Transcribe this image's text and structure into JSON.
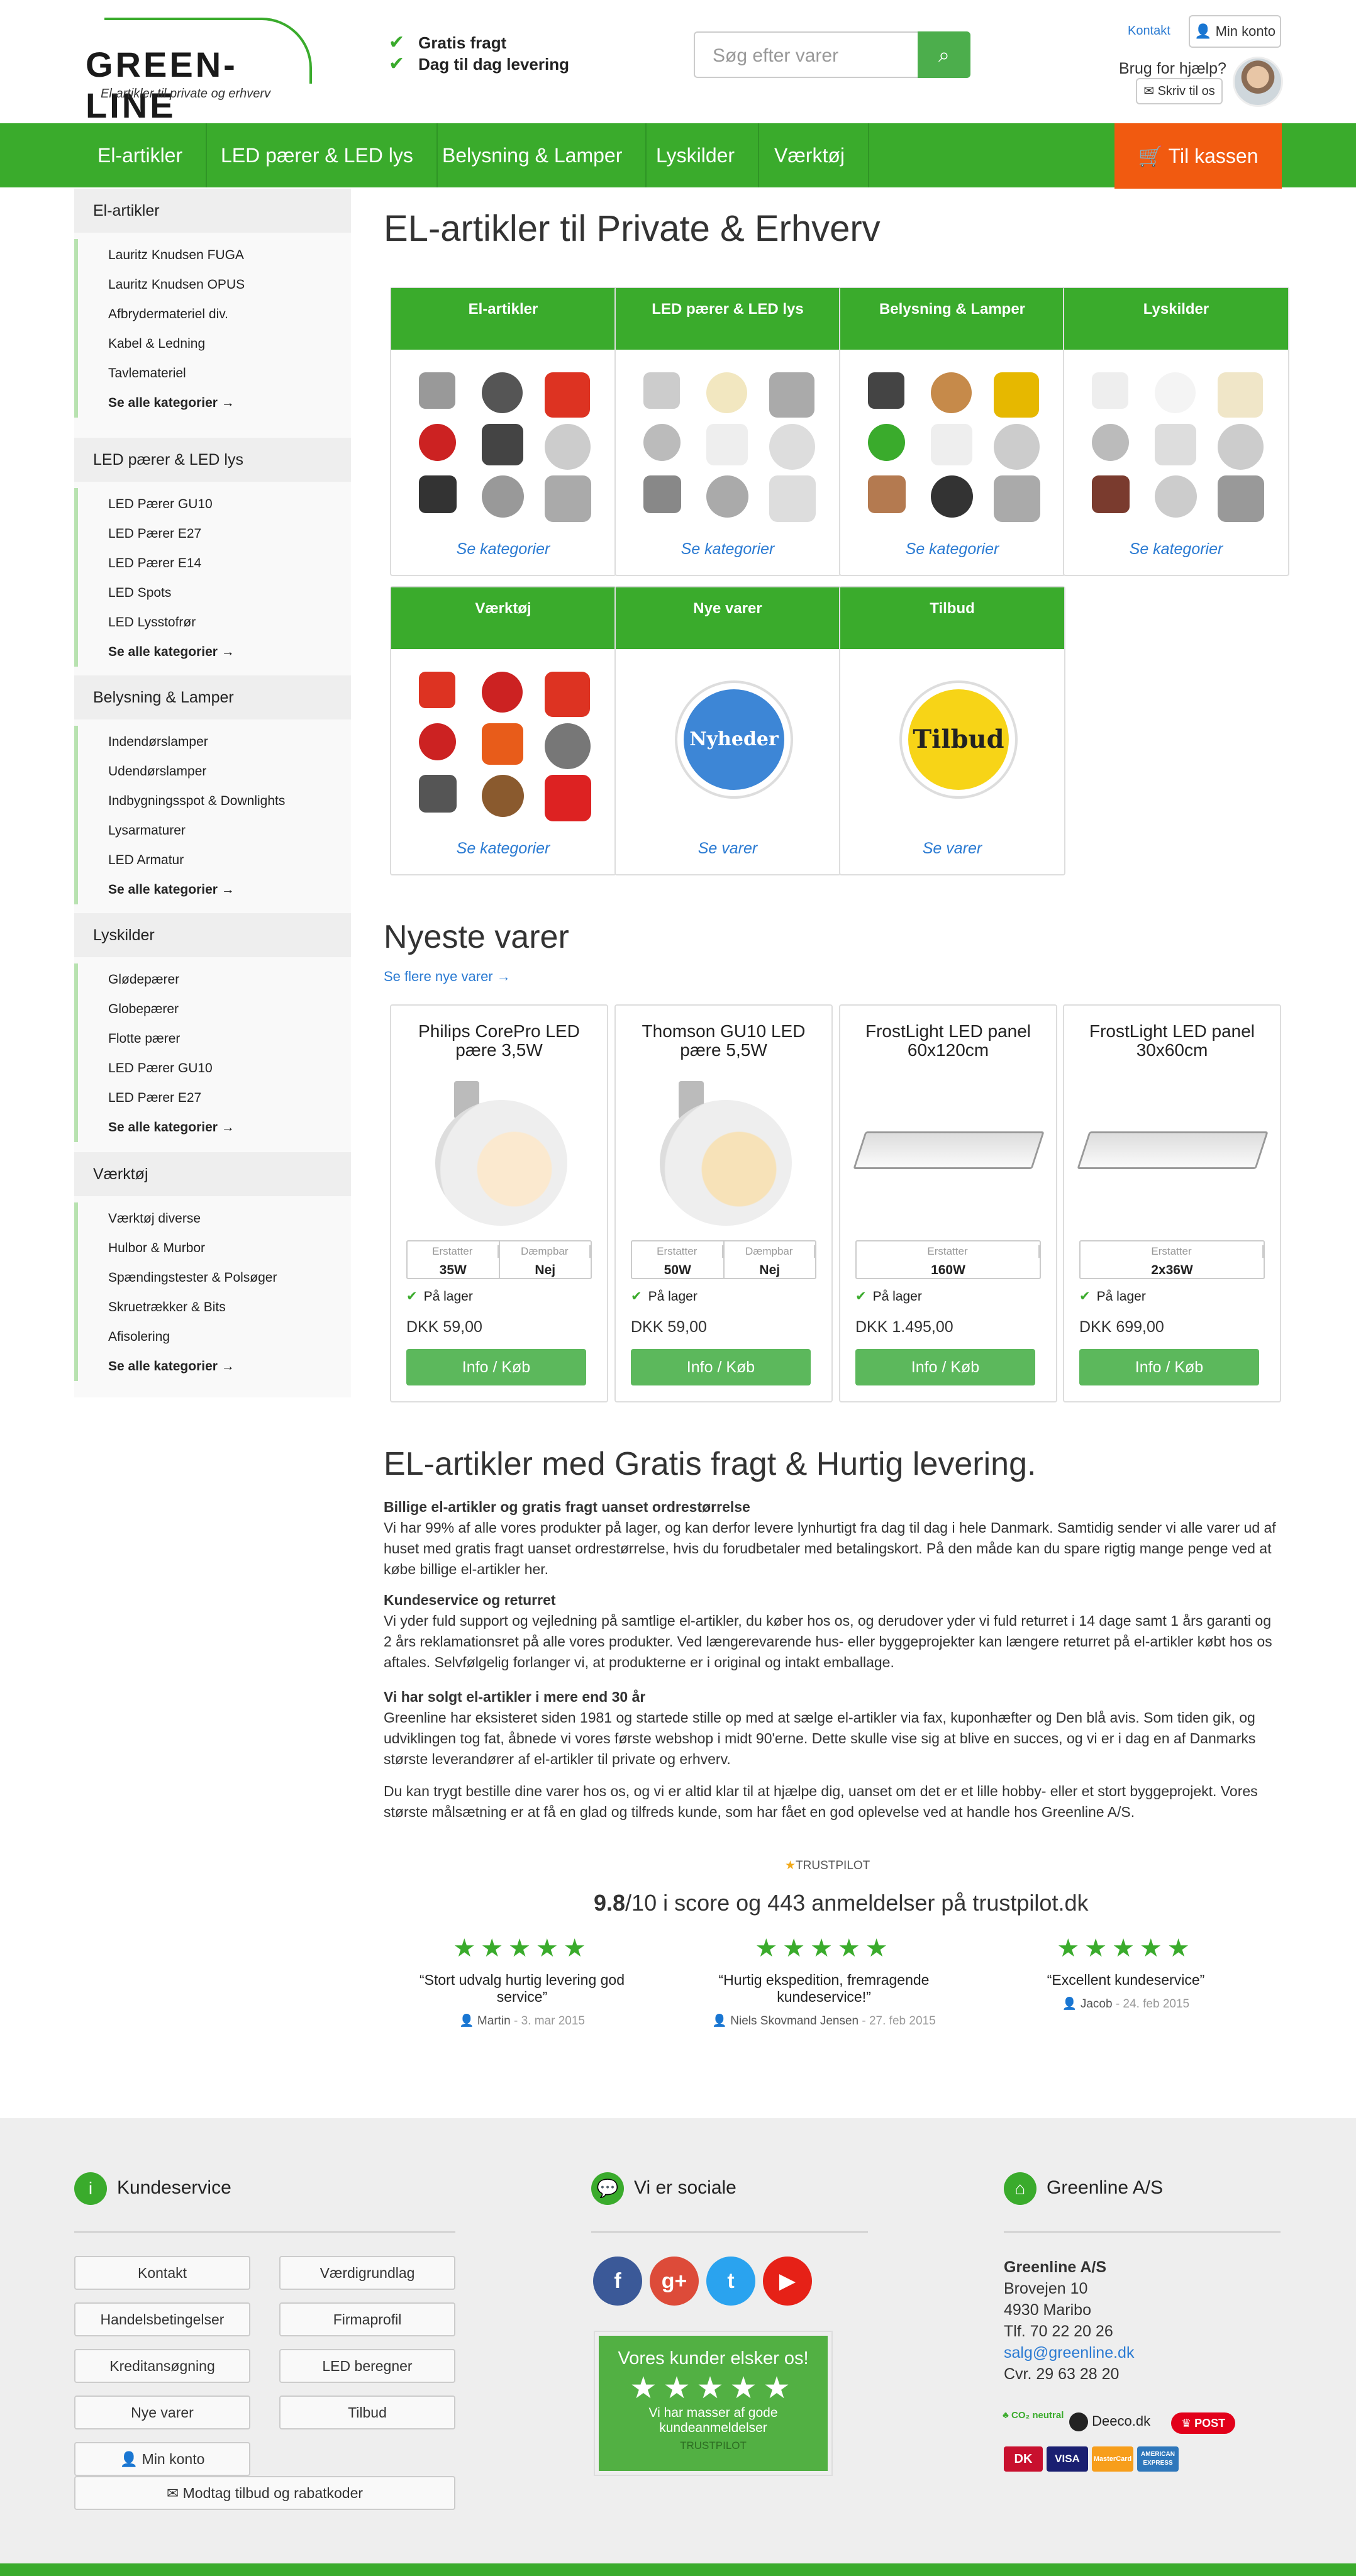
{
  "header": {
    "logo_text": "GREEN-LINE",
    "logo_tagline": "El-artikler til private og erhverv",
    "usps": [
      "Gratis fragt",
      "Dag til dag levering"
    ],
    "search_placeholder": "Søg efter varer",
    "contact_link": "Kontakt",
    "account_btn": "Min konto",
    "help_text": "Brug for hjælp?",
    "write_btn": "Skriv til os"
  },
  "nav": {
    "items": [
      "El-artikler",
      "LED pærer & LED lys",
      "Belysning & Lamper",
      "Lyskilder",
      "Værktøj"
    ],
    "checkout": "Til kassen"
  },
  "sidebar": [
    {
      "title": "El-artikler",
      "items": [
        "Lauritz Knudsen FUGA",
        "Lauritz Knudsen OPUS",
        "Afbrydermateriel div.",
        "Kabel & Ledning",
        "Tavlemateriel"
      ],
      "more": "Se alle kategorier →"
    },
    {
      "title": "LED pærer & LED lys",
      "items": [
        "LED Pærer GU10",
        "LED Pærer E27",
        "LED Pærer E14",
        "LED Spots",
        "LED Lysstofrør"
      ],
      "more": "Se alle kategorier →"
    },
    {
      "title": "Belysning & Lamper",
      "items": [
        "Indendørslamper",
        "Udendørslamper",
        "Indbygningsspot & Downlights",
        "Lysarmaturer",
        "LED Armatur"
      ],
      "more": "Se alle kategorier →"
    },
    {
      "title": "Lyskilder",
      "items": [
        "Glødepærer",
        "Globepærer",
        "Flotte pærer",
        "LED Pærer GU10",
        "LED Pærer E27"
      ],
      "more": "Se alle kategorier →"
    },
    {
      "title": "Værktøj",
      "items": [
        "Værktøj diverse",
        "Hulbor & Murbor",
        "Spændingstester & Polsøger",
        "Skruetrækker & Bits",
        "Afisolering"
      ],
      "more": "Se alle kategorier →"
    }
  ],
  "main": {
    "title": "EL-artikler til Private & Erhverv",
    "categories": [
      {
        "name": "El-artikler",
        "link": "Se kategorier"
      },
      {
        "name": "LED pærer & LED lys",
        "link": "Se kategorier"
      },
      {
        "name": "Belysning & Lamper",
        "link": "Se kategorier"
      },
      {
        "name": "Lyskilder",
        "link": "Se kategorier"
      },
      {
        "name": "Værktøj",
        "link": "Se kategorier"
      },
      {
        "name": "Nye varer",
        "link": "Se varer",
        "badge": "Nyheder"
      },
      {
        "name": "Tilbud",
        "link": "Se varer",
        "badge": "Tilbud"
      }
    ],
    "newest_title": "Nyeste varer",
    "newest_link": "Se flere nye varer →",
    "products": [
      {
        "title": "Philips CorePro LED pære 3,5W",
        "specs": [
          {
            "label": "Erstatter",
            "value": "35W"
          },
          {
            "label": "Dæmpbar",
            "value": "Nej"
          }
        ],
        "stock": "På lager",
        "price": "DKK 59,00",
        "button": "Info / Køb"
      },
      {
        "title": "Thomson GU10 LED pære 5,5W",
        "specs": [
          {
            "label": "Erstatter",
            "value": "50W"
          },
          {
            "label": "Dæmpbar",
            "value": "Nej"
          }
        ],
        "stock": "På lager",
        "price": "DKK 59,00",
        "button": "Info / Køb"
      },
      {
        "title": "FrostLight LED panel 60x120cm",
        "specs": [
          {
            "label": "Erstatter",
            "value": "160W"
          }
        ],
        "stock": "På lager",
        "price": "DKK 1.495,00",
        "button": "Info / Køb"
      },
      {
        "title": "FrostLight LED panel 30x60cm",
        "specs": [
          {
            "label": "Erstatter",
            "value": "2x36W"
          }
        ],
        "stock": "På lager",
        "price": "DKK 699,00",
        "button": "Info / Køb"
      }
    ],
    "info_title": "EL-artikler med Gratis fragt & Hurtig levering.",
    "info_sections": [
      {
        "heading": "Billige el-artikler og gratis fragt uanset ordrestørrelse",
        "body": "Vi har 99% af alle vores produkter på lager, og kan derfor levere lynhurtigt fra dag til dag i hele Danmark. Samtidig sender vi alle varer ud af huset med gratis fragt uanset ordrestørrelse, hvis du forudbetaler med betalingskort. På den måde kan du spare rigtig mange penge ved at købe billige el-artikler her."
      },
      {
        "heading": "Kundeservice og returret",
        "body": "Vi yder fuld support og vejledning på samtlige el-artikler, du køber hos os, og derudover yder vi fuld returret i 14 dage samt 1 års garanti og 2 års reklamationsret på alle vores produkter. Ved længerevarende hus- eller byggeprojekter kan længere returret på el-artikler købt hos os aftales. Selvfølgelig forlanger vi, at produkterne er i original og intakt emballage."
      },
      {
        "heading": "Vi har solgt el-artikler i mere end 30 år",
        "body": "Greenline har eksisteret siden 1981 og startede stille op med at sælge el-artikler via fax, kuponhæfter og Den blå avis. Som tiden gik, og udviklingen tog fat, åbnede vi vores første webshop i midt 90'erne. Dette skulle vise sig at blive en succes, og vi er i dag en af Danmarks største leverandører af el-artikler til private og erhverv."
      },
      {
        "heading": "",
        "body": "Du kan trygt bestille dine varer hos os, og vi er altid klar til at hjælpe dig, uanset om det er et lille hobby- eller et stort byggeprojekt. Vores største målsætning er at få en glad og tilfreds kunde, som har fået en god oplevelse ved at handle hos Greenline A/S."
      }
    ],
    "trustpilot": {
      "brand": "TRUSTPILOT",
      "score": "9.8",
      "rating_rest": "/10 i score og 443 anmeldelser på trustpilot.dk",
      "reviews": [
        {
          "text": "“Stort udvalg hurtig levering god service”",
          "author": "Martin",
          "date": " - 3. mar 2015"
        },
        {
          "text": "“Hurtig ekspedition, fremragende kundeservice!”",
          "author": "Niels Skovmand Jensen",
          "date": " - 27. feb 2015"
        },
        {
          "text": "“Excellent kundeservice”",
          "author": "Jacob",
          "date": " - 24. feb 2015"
        }
      ]
    }
  },
  "footer": {
    "service_title": "Kundeservice",
    "service_buttons": [
      "Kontakt",
      "Værdigrundlag",
      "Handelsbetingelser",
      "Firmaprofil",
      "Kreditansøgning",
      "LED beregner",
      "Nye varer",
      "Tilbud",
      "Min konto"
    ],
    "offers_btn": "Modtag tilbud og rabatkoder",
    "social_title": "Vi er sociale",
    "tp_box": {
      "title": "Vores kunder elsker os!",
      "text": "Vi har masser af gode kundeanmeldelser",
      "brand": "TRUSTPILOT"
    },
    "company_title": "Greenline A/S",
    "company": {
      "name": "Greenline A/S",
      "street": "Brovejen 10",
      "city": "4930 Maribo",
      "phone": "Tlf. 70 22 20 26",
      "email": "salg@greenline.dk",
      "cvr": "Cvr. 29 63 28 20"
    },
    "partners": [
      "CO₂ neutral",
      "Deeco.dk",
      "POST"
    ],
    "payments": [
      "DK",
      "VISA",
      "MasterCard",
      "AMERICAN EXPRESS"
    ]
  }
}
